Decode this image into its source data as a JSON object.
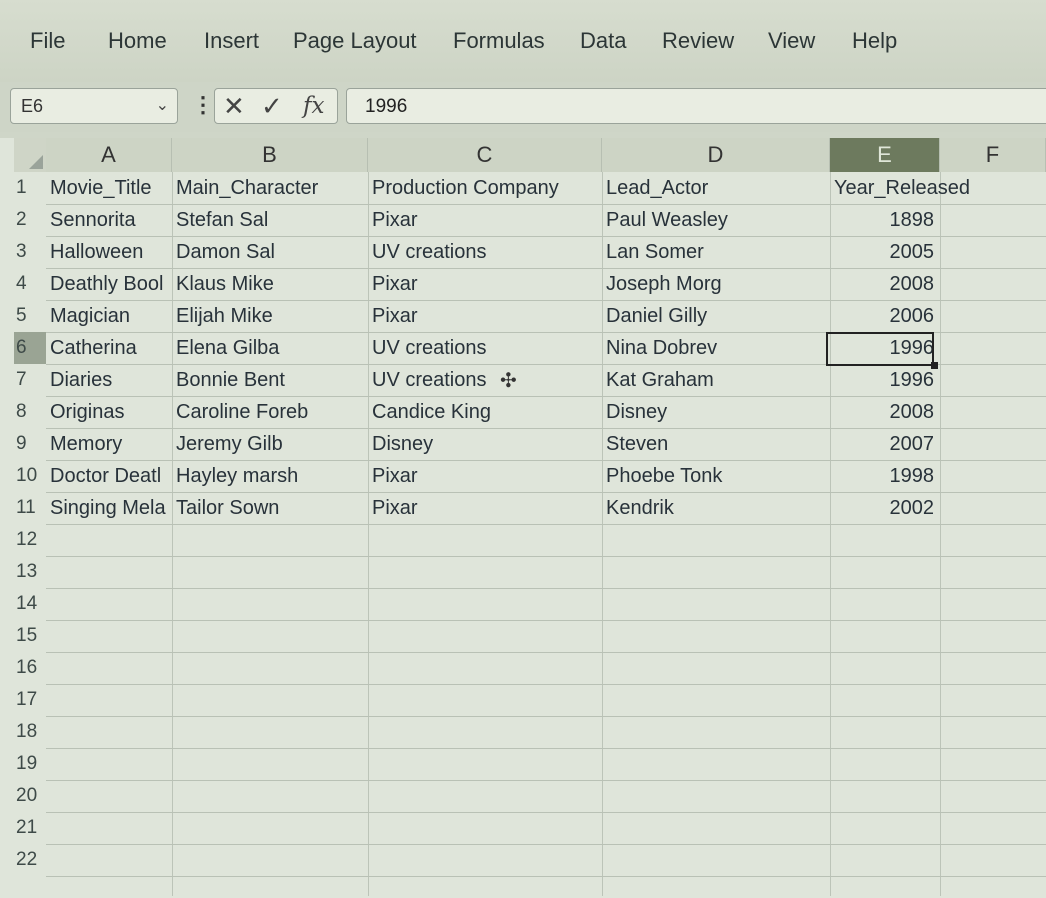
{
  "menu": [
    "File",
    "Home",
    "Insert",
    "Page Layout",
    "Formulas",
    "Data",
    "Review",
    "View",
    "Help"
  ],
  "formula_bar": {
    "name_box": "E6",
    "cancel_glyph": "✕",
    "enter_glyph": "✓",
    "fx_glyph": "fx",
    "value": "1996"
  },
  "columns": [
    "A",
    "B",
    "C",
    "D",
    "E",
    "F"
  ],
  "active_column": "E",
  "active_row": "6",
  "row_numbers": [
    "1",
    "2",
    "3",
    "4",
    "5",
    "6",
    "7",
    "8",
    "9",
    "10",
    "11",
    "12",
    "13",
    "14",
    "15",
    "16",
    "17",
    "18",
    "19",
    "20",
    "21",
    "22"
  ],
  "rows": [
    [
      "Movie_Title",
      "Main_Character",
      "Production Company",
      "Lead_Actor",
      "Year_Released"
    ],
    [
      "Sennorita",
      "Stefan Sal",
      "Pixar",
      "Paul Weasley",
      "1898"
    ],
    [
      "Halloween",
      "Damon Sal",
      "UV creations",
      "Lan Somer",
      "2005"
    ],
    [
      "Deathly Bool",
      "Klaus Mike",
      "Pixar",
      "Joseph Morg",
      "2008"
    ],
    [
      "Magician",
      "Elijah Mike",
      "Pixar",
      "Daniel Gilly",
      "2006"
    ],
    [
      "Catherina",
      "Elena Gilba",
      "UV creations",
      "Nina Dobrev",
      "1996"
    ],
    [
      "Diaries",
      "Bonnie Bent",
      "UV creations",
      "Kat Graham",
      "1996"
    ],
    [
      "Originas",
      "Caroline Foreb",
      "Candice King",
      "Disney",
      "2008"
    ],
    [
      "Memory",
      "Jeremy Gilb",
      "Disney",
      "Steven",
      "2007"
    ],
    [
      "Doctor Deatl",
      "Hayley marsh",
      "Pixar",
      "Phoebe Tonk",
      "1998"
    ],
    [
      "Singing Mela",
      "Tailor Sown",
      "Pixar",
      "Kendrik",
      "2002"
    ]
  ]
}
